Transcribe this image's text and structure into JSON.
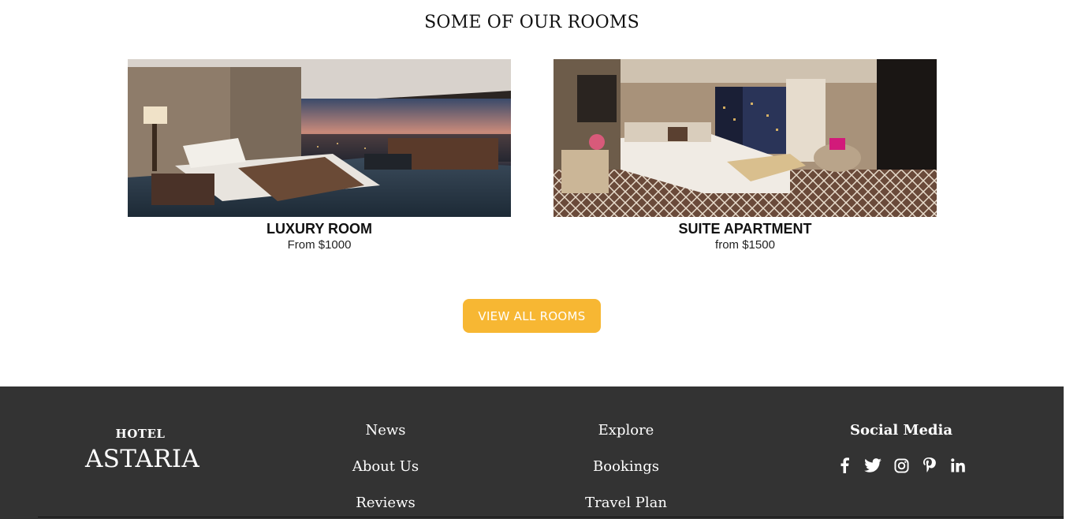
{
  "rooms_section": {
    "title": "SOME OF OUR ROOMS",
    "rooms": [
      {
        "name": "LUXURY ROOM",
        "price": "From $1000"
      },
      {
        "name": "SUITE APARTMENT",
        "price": "from $1500"
      }
    ],
    "view_all_label": "VIEW ALL ROOMS"
  },
  "footer": {
    "brand": {
      "top": "HOTEL",
      "main": "ASTARIA"
    },
    "column_1": [
      "News",
      "About Us",
      "Reviews"
    ],
    "column_2": [
      "Explore",
      "Bookings",
      "Travel Plan"
    ],
    "social": {
      "title": "Social Media",
      "icons": [
        "facebook-icon",
        "twitter-icon",
        "instagram-icon",
        "pinterest-icon",
        "linkedin-icon"
      ]
    }
  },
  "colors": {
    "accent": "#f7b733",
    "footer_bg": "#333333",
    "text_dark": "#111111"
  }
}
